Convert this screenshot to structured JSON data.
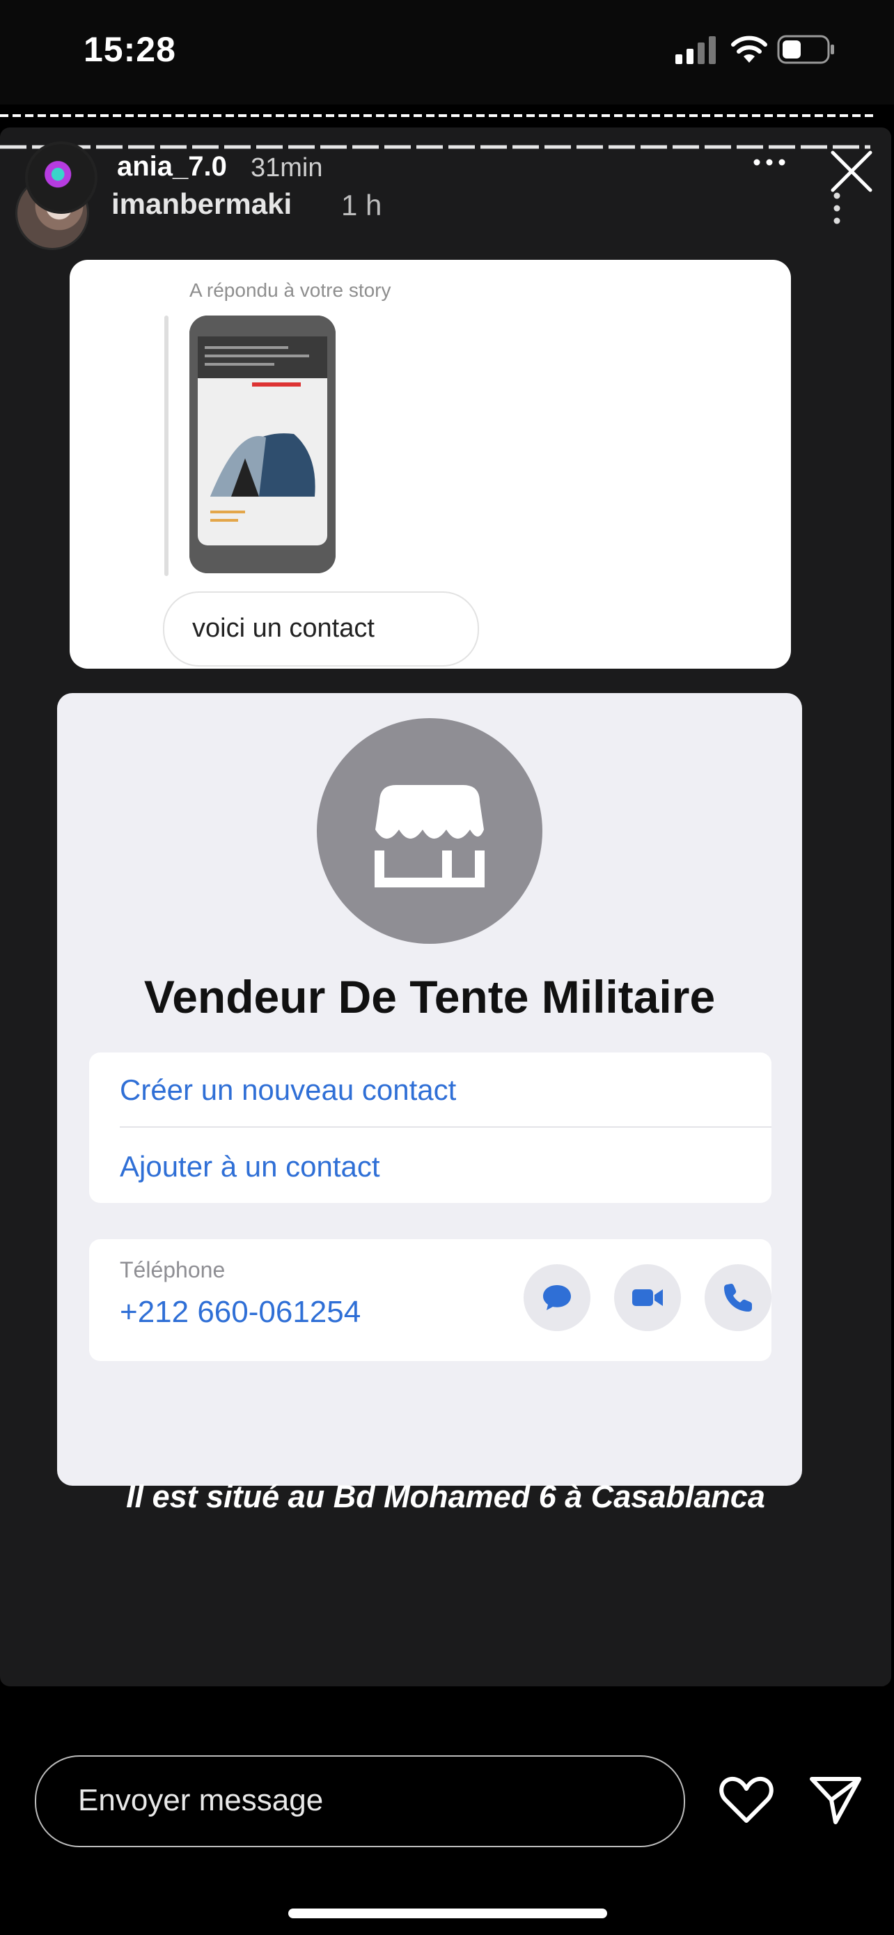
{
  "status_bar": {
    "time": "15:28"
  },
  "story": {
    "users": [
      {
        "username": "ania_7.0",
        "time_ago": "31min"
      },
      {
        "username": "imanbermaki",
        "time_ago": "1 h"
      }
    ],
    "reply_card": {
      "replied_label": "A répondu à votre story",
      "message": "voici un contact"
    },
    "contact_card": {
      "name": "Vendeur De Tente Militaire",
      "options": [
        "Créer un nouveau contact",
        "Ajouter à un contact"
      ],
      "phone_label": "Téléphone",
      "phone_number": "+212 660-061254",
      "action_icons": [
        "message-icon",
        "video-icon",
        "phone-icon"
      ],
      "accent_color": "#2f6fd6"
    },
    "caption": "Il est situé au Bd Mohamed 6 à Casablanca"
  },
  "footer": {
    "message_placeholder": "Envoyer message"
  }
}
